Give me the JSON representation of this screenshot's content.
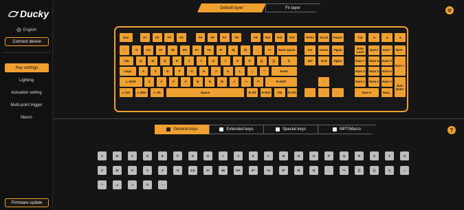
{
  "app": {
    "logo_text": "Ducky"
  },
  "sidebar": {
    "language": "English",
    "connect_label": "Connect device",
    "nav": [
      "Key settings",
      "Lighting",
      "Actuation setting",
      "Multi-point trigger",
      "Macro"
    ],
    "active_nav": "Key settings",
    "firmware_label": "Firmware update"
  },
  "layers": {
    "tabs": [
      "Default layer",
      "Fn layer"
    ],
    "active": "Default layer"
  },
  "keyboard": {
    "accent": "#f0a030",
    "rows": [
      [
        [
          "Esc",
          0,
          0,
          15
        ],
        [
          "F1",
          24,
          0,
          11
        ],
        [
          "F2",
          38,
          0,
          11
        ],
        [
          "F3",
          52,
          0,
          11
        ],
        [
          "F4",
          66,
          0,
          11
        ],
        [
          "F5",
          88,
          0,
          11
        ],
        [
          "F6",
          102,
          0,
          11
        ],
        [
          "F7",
          116,
          0,
          11
        ],
        [
          "F8",
          130,
          0,
          11
        ],
        [
          "F9",
          152,
          0,
          11
        ],
        [
          "F10",
          166,
          0,
          11
        ],
        [
          "F11",
          180,
          0,
          11
        ],
        [
          "F12",
          194,
          0,
          11
        ],
        [
          "PrtSc",
          214,
          0,
          13
        ],
        [
          "ScrLk",
          230,
          0,
          13
        ],
        [
          "Pause",
          246,
          0,
          13
        ],
        [
          "Cal",
          272,
          0,
          13
        ],
        [
          "◂",
          288,
          0,
          13
        ],
        [
          "◂",
          303,
          0,
          13
        ],
        [
          "◂",
          318,
          0,
          13
        ]
      ],
      [
        [
          "~",
          0,
          18,
          11
        ],
        [
          "!1",
          14,
          18,
          11
        ],
        [
          "2@",
          28,
          18,
          11
        ],
        [
          "3#",
          42,
          18,
          11
        ],
        [
          "4$",
          56,
          18,
          11
        ],
        [
          "5%",
          70,
          18,
          11
        ],
        [
          "6^",
          84,
          18,
          11
        ],
        [
          "7&",
          98,
          18,
          11
        ],
        [
          "8*",
          112,
          18,
          11
        ],
        [
          "9(",
          126,
          18,
          11
        ],
        [
          "0)",
          140,
          18,
          11
        ],
        [
          "-_",
          154,
          18,
          11
        ],
        [
          "=+",
          168,
          18,
          11
        ],
        [
          "Back space",
          182,
          18,
          23
        ],
        [
          "Ins",
          214,
          18,
          13
        ],
        [
          "Home",
          230,
          18,
          13
        ],
        [
          "PgUp",
          246,
          18,
          13
        ],
        [
          "Num Lock",
          272,
          18,
          13
        ],
        [
          "Num /",
          288,
          18,
          13
        ],
        [
          "Num *",
          303,
          18,
          13
        ],
        [
          "Num -",
          318,
          18,
          13
        ]
      ],
      [
        [
          "Tab",
          0,
          33,
          16
        ],
        [
          "Q",
          19,
          33,
          11
        ],
        [
          "W",
          33,
          33,
          11
        ],
        [
          "E",
          47,
          33,
          11
        ],
        [
          "R",
          61,
          33,
          11
        ],
        [
          "T",
          75,
          33,
          11
        ],
        [
          "Y",
          89,
          33,
          11
        ],
        [
          "U",
          103,
          33,
          11
        ],
        [
          "I",
          117,
          33,
          11
        ],
        [
          "O",
          131,
          33,
          11
        ],
        [
          "P",
          145,
          33,
          11
        ],
        [
          "[{",
          159,
          33,
          11
        ],
        [
          "]}",
          173,
          33,
          11
        ],
        [
          "\\|",
          187,
          33,
          18
        ],
        [
          "Del",
          214,
          33,
          13
        ],
        [
          "End",
          230,
          33,
          13
        ],
        [
          "PgDn",
          246,
          33,
          13
        ],
        [
          "Num 7",
          272,
          33,
          13
        ],
        [
          "Num 8",
          288,
          33,
          13
        ],
        [
          "Num 9",
          303,
          33,
          13
        ]
      ],
      [
        [
          "Caps",
          0,
          48,
          19
        ],
        [
          "A",
          22,
          48,
          11
        ],
        [
          "S",
          36,
          48,
          11
        ],
        [
          "D",
          50,
          48,
          11
        ],
        [
          "F",
          64,
          48,
          11
        ],
        [
          "G",
          78,
          48,
          11
        ],
        [
          "H",
          92,
          48,
          11
        ],
        [
          "J",
          106,
          48,
          11
        ],
        [
          "K",
          120,
          48,
          11
        ],
        [
          "L",
          134,
          48,
          11
        ],
        [
          ";:",
          148,
          48,
          11
        ],
        [
          "'\"",
          162,
          48,
          11
        ],
        [
          "Enter",
          176,
          48,
          29
        ],
        [
          "Num 4",
          272,
          48,
          13
        ],
        [
          "Num 5",
          288,
          48,
          13
        ],
        [
          "Num 6",
          303,
          48,
          13
        ]
      ],
      [
        [
          "L-Shift",
          0,
          63,
          26
        ],
        [
          "Z",
          29,
          63,
          11
        ],
        [
          "X",
          43,
          63,
          11
        ],
        [
          "C",
          57,
          63,
          11
        ],
        [
          "V",
          71,
          63,
          11
        ],
        [
          "B",
          85,
          63,
          11
        ],
        [
          "N",
          99,
          63,
          11
        ],
        [
          "M",
          113,
          63,
          11
        ],
        [
          ",<",
          127,
          63,
          11
        ],
        [
          ".>",
          141,
          63,
          11
        ],
        [
          "/?",
          155,
          63,
          11
        ],
        [
          "R-Shift",
          169,
          63,
          36
        ],
        [
          "↑",
          230,
          63,
          13
        ],
        [
          "Num 1",
          272,
          63,
          13
        ],
        [
          "Num 2",
          288,
          63,
          13
        ],
        [
          "Num 3",
          303,
          63,
          13
        ]
      ],
      [
        [
          "L-Ctrl",
          0,
          78,
          15
        ],
        [
          "L-Win",
          18,
          78,
          15
        ],
        [
          "L-Alt",
          36,
          78,
          15
        ],
        [
          "Space",
          54,
          78,
          90
        ],
        [
          "R-Alt",
          147,
          78,
          13
        ],
        [
          "R-Win",
          163,
          78,
          13
        ],
        [
          "FN",
          179,
          78,
          13
        ],
        [
          "R-Ctrl",
          194,
          78,
          11
        ],
        [
          "←",
          214,
          78,
          13
        ],
        [
          "↓",
          230,
          78,
          13
        ],
        [
          "→",
          246,
          78,
          13
        ],
        [
          "Num 0",
          272,
          78,
          28
        ],
        [
          "Num .",
          303,
          78,
          13
        ]
      ],
      [
        [
          "Num +",
          318,
          33,
          13,
          28
        ],
        [
          "Num Enter",
          318,
          63,
          13,
          28
        ]
      ]
    ]
  },
  "categories": {
    "tabs": [
      "General keys",
      "Extended keys",
      "Special keys",
      "MPT/Macro"
    ],
    "active": "General keys"
  },
  "general_keys": {
    "row1": [
      "A",
      "B",
      "C",
      "D",
      "E",
      "F",
      "G",
      "H",
      "I",
      "J",
      "K",
      "L",
      "M",
      "N",
      "O",
      "P",
      "Q",
      "R",
      "S",
      "T",
      "U"
    ],
    "row2": [
      "V",
      "W",
      "X",
      "Y",
      "Z",
      "!1",
      "2@",
      "3#",
      "4$",
      "5%",
      "6^",
      "7&",
      "8*",
      "9(",
      "0)",
      "-_",
      "=+",
      "[{",
      "]}",
      "\\|",
      ";:"
    ],
    "row3": [
      "'\"",
      ",<",
      ".>",
      "/?",
      "`~"
    ]
  }
}
